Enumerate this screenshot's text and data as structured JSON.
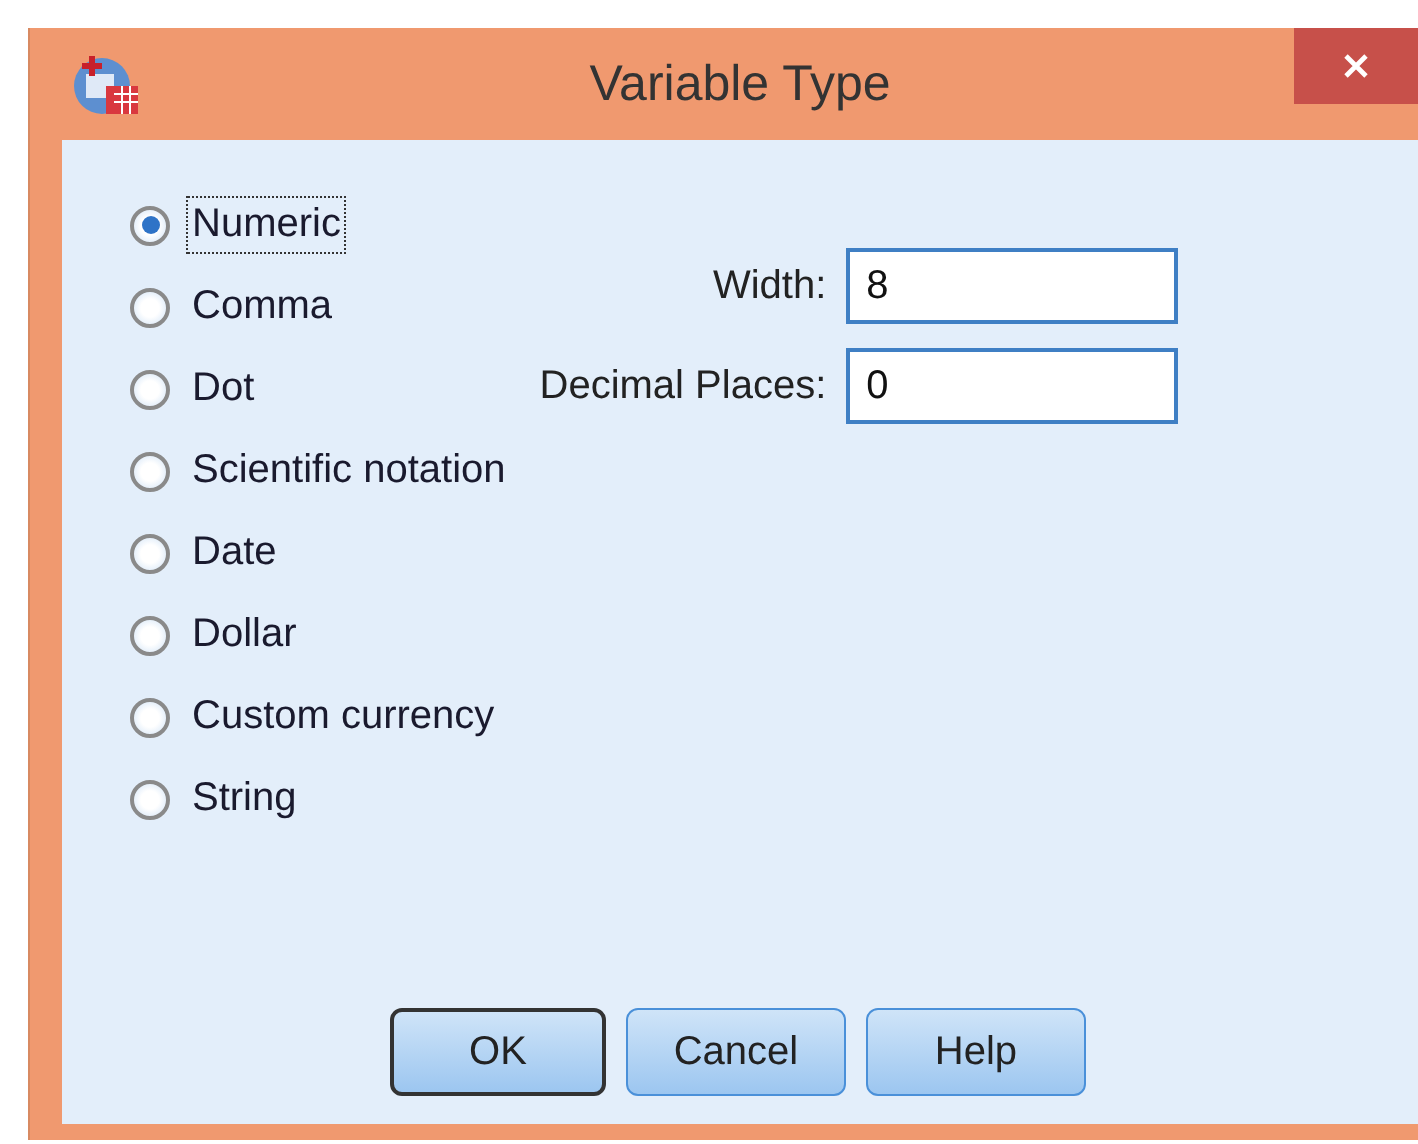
{
  "window": {
    "title": "Variable Type"
  },
  "types": [
    {
      "label": "Numeric",
      "selected": true,
      "focused": true
    },
    {
      "label": "Comma",
      "selected": false,
      "focused": false
    },
    {
      "label": "Dot",
      "selected": false,
      "focused": false
    },
    {
      "label": "Scientific notation",
      "selected": false,
      "focused": false
    },
    {
      "label": "Date",
      "selected": false,
      "focused": false
    },
    {
      "label": "Dollar",
      "selected": false,
      "focused": false
    },
    {
      "label": "Custom currency",
      "selected": false,
      "focused": false
    },
    {
      "label": "String",
      "selected": false,
      "focused": false
    }
  ],
  "fields": [
    {
      "label": "Width:",
      "value": "8"
    },
    {
      "label": "Decimal Places:",
      "value": "0"
    }
  ],
  "buttons": [
    {
      "label": "OK",
      "default": true
    },
    {
      "label": "Cancel",
      "default": false
    },
    {
      "label": "Help",
      "default": false
    }
  ]
}
